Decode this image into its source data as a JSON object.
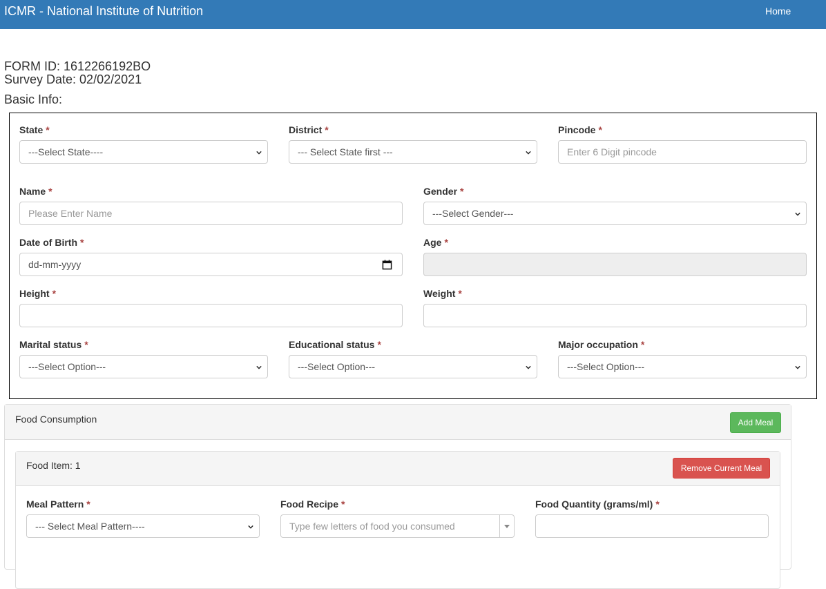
{
  "navbar": {
    "brand": "ICMR - National Institute of Nutrition",
    "home": "Home"
  },
  "meta": {
    "form_id": "FORM ID: 1612266192BO",
    "survey_date": "Survey Date: 02/02/2021",
    "section_title": "Basic Info:"
  },
  "basic": {
    "state": {
      "label": "State",
      "value": "---Select State----"
    },
    "district": {
      "label": "District",
      "value": "--- Select State first ---"
    },
    "pincode": {
      "label": "Pincode",
      "placeholder": "Enter 6 Digit pincode"
    },
    "name": {
      "label": "Name",
      "placeholder": "Please Enter Name"
    },
    "gender": {
      "label": "Gender",
      "value": "---Select Gender---"
    },
    "dob": {
      "label": "Date of Birth",
      "placeholder": "dd-mm-yyyy"
    },
    "age": {
      "label": "Age",
      "value": ""
    },
    "height": {
      "label": "Height",
      "value": ""
    },
    "weight": {
      "label": "Weight",
      "value": ""
    },
    "marital": {
      "label": "Marital status",
      "value": "---Select Option---"
    },
    "education": {
      "label": "Educational status",
      "value": "---Select Option---"
    },
    "occupation": {
      "label": "Major occupation",
      "value": "---Select Option---"
    },
    "required_mark": "*"
  },
  "food": {
    "panel_title": "Food Consumption",
    "add_meal": "Add Meal",
    "item_title": "Food Item: 1",
    "remove_meal": "Remove Current Meal",
    "meal_pattern": {
      "label": "Meal Pattern",
      "value": "--- Select Meal Pattern----"
    },
    "food_recipe": {
      "label": "Food Recipe",
      "placeholder": "Type few letters of food you consumed"
    },
    "food_quantity": {
      "label": "Food Quantity (grams/ml)",
      "value": ""
    }
  },
  "colors": {
    "navbar": "#337ab7",
    "success": "#5cb85c",
    "danger": "#d9534f",
    "required": "#a94442"
  },
  "icons": [
    "chevron-down-icon",
    "calendar-icon",
    "caret-down-icon"
  ]
}
